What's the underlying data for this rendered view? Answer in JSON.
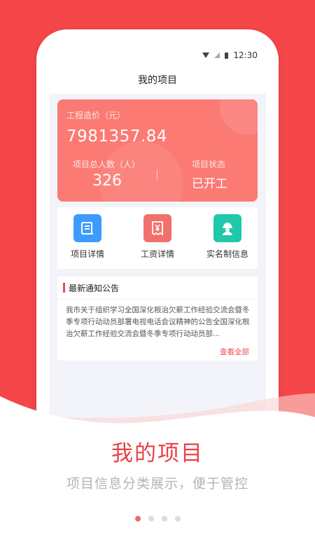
{
  "status_bar": {
    "time": "12:30"
  },
  "nav": {
    "title": "我的项目"
  },
  "summary": {
    "cost_label": "工程造价（元）",
    "cost_value": "7981357.84",
    "people_label": "项目总人数（人）",
    "people_value": "326",
    "status_label": "项目状态",
    "status_value": "已开工"
  },
  "quick_actions": [
    {
      "label": "项目详情",
      "icon": "document-icon",
      "color": "#3d9bff"
    },
    {
      "label": "工资详情",
      "icon": "yen-receipt-icon",
      "color": "#f2706b"
    },
    {
      "label": "实名制信息",
      "icon": "worker-icon",
      "color": "#1ec8a8"
    }
  ],
  "notice": {
    "title": "最新通知公告",
    "body": "我市关于组织学习全国深化根治欠薪工作经验交流会暨冬季专项行动动员部署电视电话会议精神的公告全国深化根治欠薪工作经验交流会暨冬季专项行动动员部...",
    "more": "查看全部"
  },
  "promo": {
    "headline": "我的项目",
    "subtitle": "项目信息分类展示，便于管控"
  },
  "pager": {
    "count": 4,
    "active": 1
  },
  "colors": {
    "brand": "#f5474a",
    "card": "#fb7b74"
  }
}
